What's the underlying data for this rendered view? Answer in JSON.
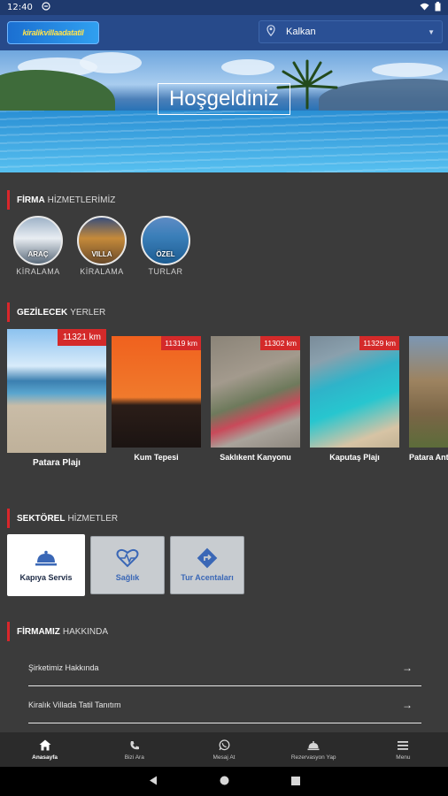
{
  "status_bar": {
    "time": "12:40",
    "icons": [
      "sync-icon",
      "wifi-icon",
      "battery-icon"
    ]
  },
  "app_bar": {
    "logo_text": "kiralikvillaadatatil",
    "location": {
      "label": "Kalkan"
    }
  },
  "hero": {
    "title": "Hoşgeldiniz"
  },
  "sections": {
    "services": {
      "bold": "FİRMA",
      "rest": "HİZMETLERİMİZ"
    },
    "places": {
      "bold": "GEZİLECEK",
      "rest": "YERLER"
    },
    "sectors": {
      "bold": "SEKTÖREL",
      "rest": "HİZMETLER"
    },
    "about": {
      "bold": "FİRMAMIZ",
      "rest": "HAKKINDA"
    }
  },
  "services": [
    {
      "name": "ARAÇ",
      "sub": "KİRALAMA"
    },
    {
      "name": "VILLA",
      "sub": "KİRALAMA"
    },
    {
      "name": "ÖZEL",
      "sub": "TURLAR"
    }
  ],
  "places": [
    {
      "name": "Patara Plajı",
      "km": "11321 km"
    },
    {
      "name": "Kum Tepesi",
      "km": "11319 km"
    },
    {
      "name": "Saklıkent Kanyonu",
      "km": "11302 km"
    },
    {
      "name": "Kaputaş Plajı",
      "km": "11329 km"
    },
    {
      "name": "Patara Antik",
      "km": ""
    }
  ],
  "sectors": [
    {
      "label": "Kapıya Servis",
      "icon": "bell-icon"
    },
    {
      "label": "Sağlık",
      "icon": "heart-pulse-icon"
    },
    {
      "label": "Tur Acentaları",
      "icon": "directions-icon"
    }
  ],
  "about_items": [
    {
      "label": "Şirketimiz Hakkında"
    },
    {
      "label": "Kiralık Villada Tatil Tanıtım"
    }
  ],
  "bottom_nav": [
    {
      "label": "Anasayfa",
      "icon": "home-icon",
      "active": true
    },
    {
      "label": "Bizi Ara",
      "icon": "phone-icon",
      "active": false
    },
    {
      "label": "Mesaj At",
      "icon": "whatsapp-icon",
      "active": false
    },
    {
      "label": "Rezervasyon Yap",
      "icon": "bell-icon",
      "active": false
    },
    {
      "label": "Menu",
      "icon": "menu-icon",
      "active": false
    }
  ],
  "colors": {
    "accent_red": "#d9262b",
    "app_bar": "#274a8a",
    "background": "#3b3b3b"
  }
}
